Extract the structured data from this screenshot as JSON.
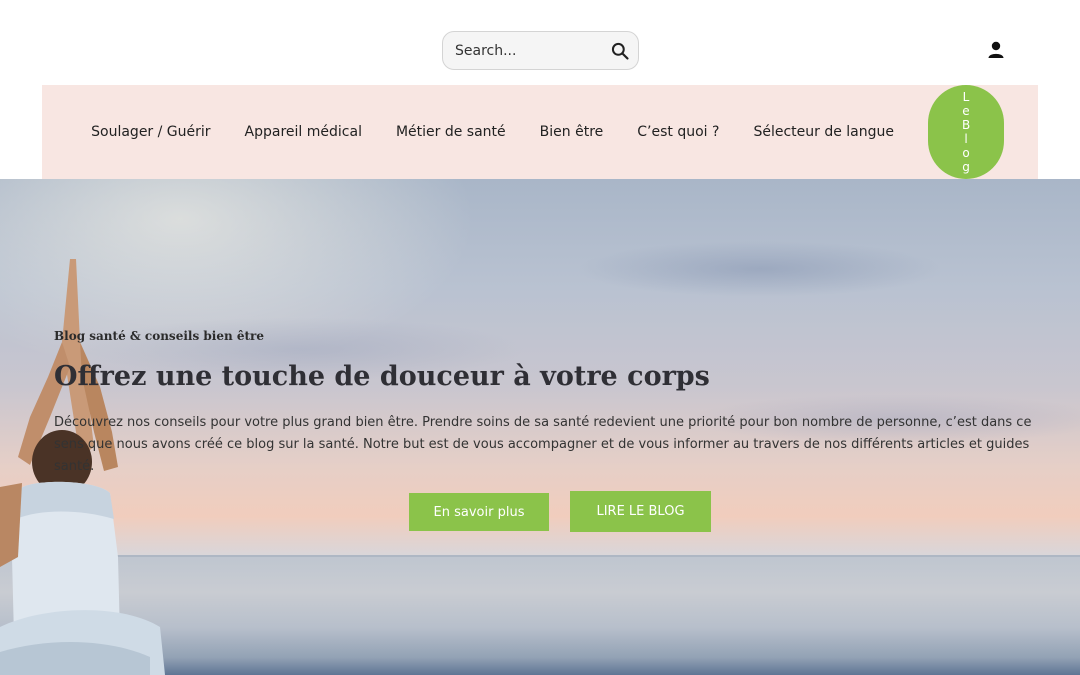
{
  "header": {
    "search_placeholder": "Search...",
    "search_icon": "search-icon",
    "user_icon": "user-icon"
  },
  "nav": {
    "items": [
      {
        "label": "Soulager / Guérir"
      },
      {
        "label": "Appareil médical"
      },
      {
        "label": "Métier de santé"
      },
      {
        "label": "Bien être"
      },
      {
        "label": "C’est quoi ?"
      },
      {
        "label": "Sélecteur de langue"
      }
    ],
    "blog_button": "LeBlog"
  },
  "hero": {
    "eyebrow": "Blog santé & conseils bien être",
    "headline": "Offrez une touche de douceur à votre corps",
    "paragraph": "Découvrez nos conseils pour votre plus grand bien être. Prendre soins de sa santé redevient une priorité pour bon nombre de personne, c’est dans ce sens que nous avons créé ce blog sur la santé. Notre but est de vous accompagner et de vous informer au travers de nos différents articles et guides santé.",
    "button_more": "En savoir plus",
    "button_blog": "LIRE LE BLOG"
  },
  "colors": {
    "accent": "#8bc34a",
    "nav_background": "#f8e6e2"
  }
}
